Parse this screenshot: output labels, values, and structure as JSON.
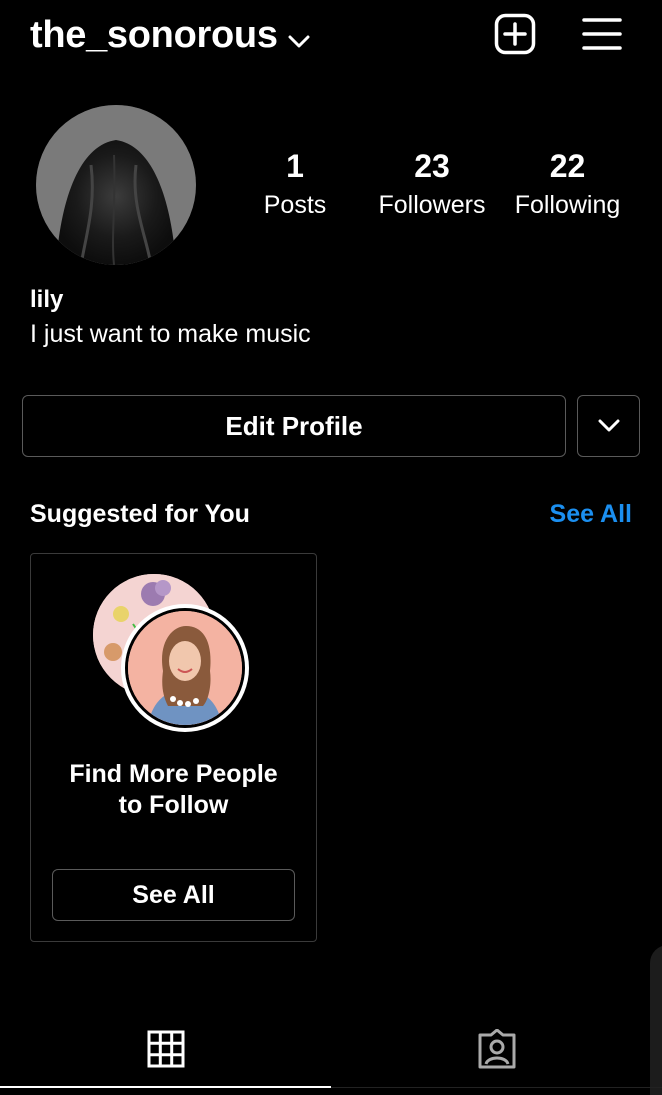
{
  "header": {
    "username": "the_sonorous",
    "icons": [
      "chevron-down-icon",
      "add-post-icon",
      "hamburger-menu-icon"
    ]
  },
  "profile": {
    "stats": [
      {
        "value": "1",
        "label": "Posts"
      },
      {
        "value": "23",
        "label": "Followers"
      },
      {
        "value": "22",
        "label": "Following"
      }
    ],
    "name": "lily",
    "bio": "I just want to make music",
    "edit_button": "Edit Profile"
  },
  "suggested": {
    "title": "Suggested for You",
    "see_all_link": "See All",
    "card": {
      "text": "Find More People to Follow",
      "button": "See All"
    }
  },
  "tabs": {
    "icons": [
      "grid-icon",
      "tagged-icon"
    ]
  },
  "colors": {
    "background": "#000000",
    "link": "#1b8ff0",
    "border": "#5a5a5a"
  }
}
